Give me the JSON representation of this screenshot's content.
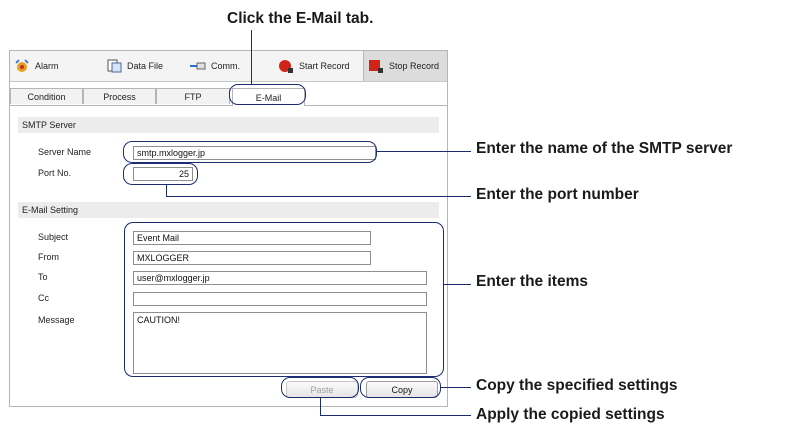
{
  "callouts": {
    "email_tab": "Click the E-Mail tab.",
    "smtp_server": "Enter the name of the SMTP server",
    "port": "Enter the port number",
    "items": "Enter the items",
    "copy": "Copy the specified settings",
    "paste": "Apply the copied settings"
  },
  "toolbar": {
    "alarm": "Alarm",
    "data_file": "Data File",
    "comm": "Comm.",
    "start_record": "Start Record",
    "stop_record": "Stop Record"
  },
  "tabs": [
    "Condition",
    "Process",
    "FTP",
    "E-Mail"
  ],
  "smtp": {
    "section_title": "SMTP Server",
    "server_name_label": "Server Name",
    "server_name_value": "smtp.mxlogger.jp",
    "port_label": "Port No.",
    "port_value": "25"
  },
  "email": {
    "section_title": "E-Mail Setting",
    "subject_label": "Subject",
    "subject_value": "Event Mail",
    "from_label": "From",
    "from_value": "MXLOGGER",
    "to_label": "To",
    "to_value": "user@mxlogger.jp",
    "cc_label": "Cc",
    "cc_value": "",
    "message_label": "Message",
    "message_value": "CAUTION!"
  },
  "buttons": {
    "paste": "Paste",
    "copy": "Copy"
  }
}
